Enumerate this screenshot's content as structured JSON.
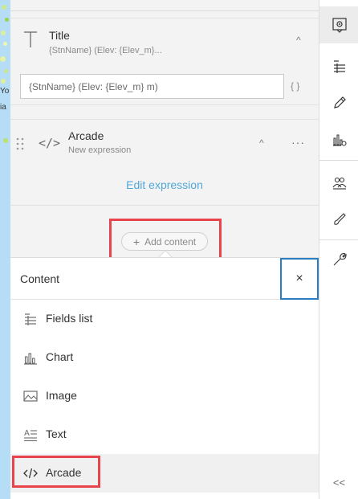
{
  "map": {
    "labels": [
      "Yo",
      "ia"
    ]
  },
  "title_block": {
    "name": "Title",
    "subtitle": "{StnName} (Elev: {Elev_m}...",
    "chevron": "^",
    "input_value": "{StnName} (Elev: {Elev_m} m)",
    "brace": "{ }"
  },
  "arcade_block": {
    "icon": "</>",
    "name": "Arcade",
    "subtitle": "New expression",
    "chevron": "^",
    "more": "···",
    "edit_link": "Edit expression"
  },
  "add_content": {
    "plus": "+",
    "label": "Add content"
  },
  "menu": {
    "title": "Content",
    "close": "×",
    "items": [
      {
        "label": "Fields list",
        "icon": "fields-list-icon"
      },
      {
        "label": "Chart",
        "icon": "chart-icon"
      },
      {
        "label": "Image",
        "icon": "image-icon"
      },
      {
        "label": "Text",
        "icon": "text-icon"
      },
      {
        "label": "Arcade",
        "icon": "code-icon"
      }
    ]
  },
  "actionbar": {
    "items": [
      "popup-settings-icon",
      "list-icon",
      "pencil-icon",
      "chart-settings-icon",
      "people-icon",
      "brush-icon",
      "wrench-icon"
    ],
    "collapse": "<<"
  },
  "colors": {
    "highlight": "#e8444b",
    "focus": "#2b7ec1",
    "link": "#51a7d8"
  }
}
